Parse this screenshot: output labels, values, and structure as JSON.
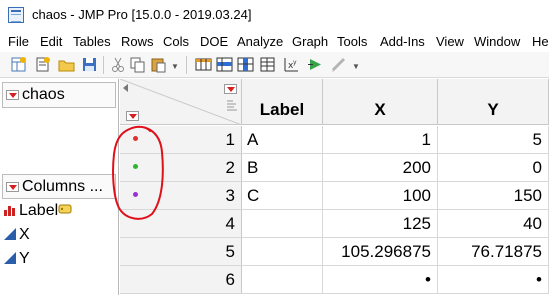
{
  "window": {
    "title": "chaos - JMP Pro [15.0.0 - 2019.03.24]"
  },
  "menu": [
    "File",
    "Edit",
    "Tables",
    "Rows",
    "Cols",
    "DOE",
    "Analyze",
    "Graph",
    "Tools",
    "Add-Ins",
    "View",
    "Window",
    "He"
  ],
  "toolbar": {
    "icons": [
      "new-data-table-icon",
      "new-script-icon",
      "open-icon",
      "save-icon",
      "cut-icon",
      "copy-icon",
      "paste-icon",
      "data-grid-icon",
      "select-rows-icon",
      "select-columns-icon",
      "column-info-icon",
      "formula-icon",
      "run-script-icon",
      "edit-icon"
    ]
  },
  "table_panel": {
    "name": "chaos"
  },
  "columns_panel": {
    "title": "Columns ...",
    "items": [
      {
        "name": "Label",
        "type": "nominal"
      },
      {
        "name": "X",
        "type": "continuous"
      },
      {
        "name": "Y",
        "type": "continuous"
      }
    ]
  },
  "grid": {
    "headers": [
      "Label",
      "X",
      "Y"
    ],
    "rows": [
      {
        "num": "1",
        "label": "A",
        "x": "1",
        "y": "5",
        "marker_color": "#e03030"
      },
      {
        "num": "2",
        "label": "B",
        "x": "200",
        "y": "0",
        "marker_color": "#2db52d"
      },
      {
        "num": "3",
        "label": "C",
        "x": "100",
        "y": "150",
        "marker_color": "#9b30d9"
      },
      {
        "num": "4",
        "label": "",
        "x": "125",
        "y": "40",
        "marker_color": ""
      },
      {
        "num": "5",
        "label": "",
        "x": "105.296875",
        "y": "76.71875",
        "marker_color": ""
      },
      {
        "num": "6",
        "label": "",
        "x": "•",
        "y": "•",
        "marker_color": ""
      }
    ]
  },
  "colors": {
    "annotation": "#e0101a"
  }
}
